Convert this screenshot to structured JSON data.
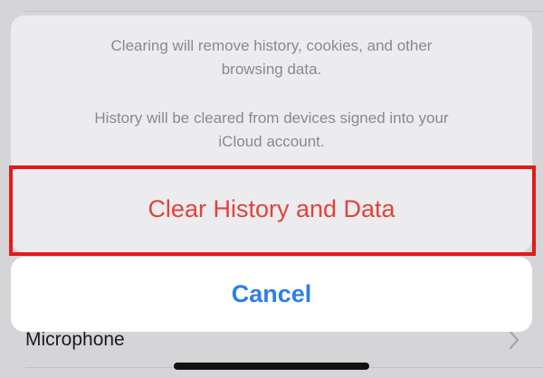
{
  "background_list": {
    "microphone_label": "Microphone"
  },
  "action_sheet": {
    "message_line_1": "Clearing will remove history, cookies, and other",
    "message_line_2": "browsing data.",
    "message_line_3": "History will be cleared from devices signed into your",
    "message_line_4": "iCloud account.",
    "destructive_label": "Clear History and Data",
    "cancel_label": "Cancel"
  },
  "colors": {
    "destructive": "#e0433b",
    "accent": "#2f7ee6",
    "highlight": "#e41a1a"
  },
  "icons": {
    "row_chevron": "chevron-right-icon"
  }
}
